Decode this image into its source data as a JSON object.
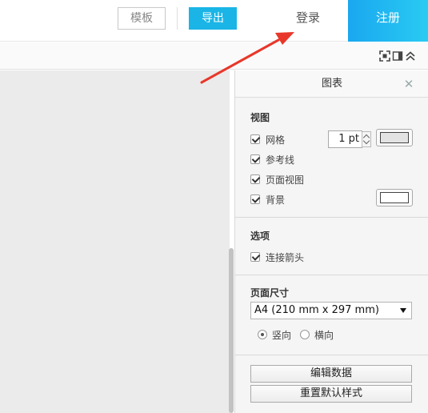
{
  "topbar": {
    "template_label": "模板",
    "export_label": "导出",
    "login_label": "登录",
    "register_label": "注册"
  },
  "toolbar": {
    "icons": [
      "fullscreen-icon",
      "panel-toggle-icon",
      "collapse-up-icon"
    ]
  },
  "panel": {
    "title": "图表",
    "close_glyph": "✕",
    "view_section": {
      "title": "视图",
      "grid_label": "网格",
      "grid_checked": true,
      "grid_size_value": "1 pt",
      "grid_color": "#e3e3e3",
      "guides_label": "参考线",
      "guides_checked": true,
      "page_view_label": "页面视图",
      "page_view_checked": true,
      "background_label": "背景",
      "background_checked": true,
      "background_color": "#ffffff"
    },
    "options_section": {
      "title": "选项",
      "connection_arrows_label": "连接箭头",
      "connection_arrows_checked": true
    },
    "page_size_section": {
      "title": "页面尺寸",
      "selected_size": "A4 (210 mm x 297 mm)",
      "portrait_label": "竖向",
      "portrait_selected": true,
      "landscape_label": "横向",
      "landscape_selected": false
    },
    "buttons": {
      "edit_data_label": "编辑数据",
      "reset_style_label": "重置默认样式"
    }
  },
  "colors": {
    "accent_blue": "#1ab5e6",
    "register_gradient_start": "#1aa7f0",
    "register_gradient_end": "#29cbf2",
    "annotation_arrow": "#e8372a",
    "canvas_bg": "#ebebeb",
    "panel_bg": "#f5f5f5"
  }
}
